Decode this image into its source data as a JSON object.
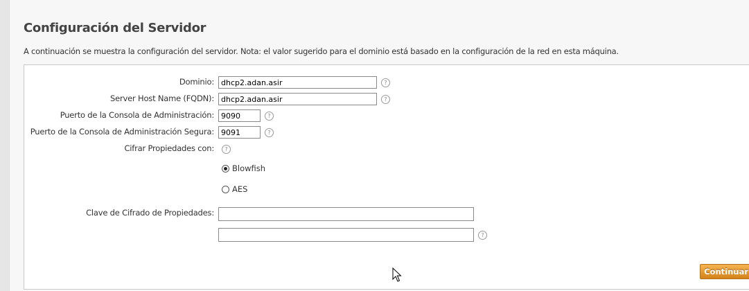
{
  "page": {
    "title": "Configuración del Servidor",
    "description": "A continuación se muestra la configuración del servidor. Nota: el valor sugerido para el dominio está basado en la configuración de la red en esta máquina."
  },
  "form": {
    "domain": {
      "label": "Dominio:",
      "value": "dhcp2.adan.asir"
    },
    "fqdn": {
      "label": "Server Host Name (FQDN):",
      "value": "dhcp2.adan.asir"
    },
    "admin_port": {
      "label": "Puerto de la Consola de Administración:",
      "value": "9090"
    },
    "admin_secure_port": {
      "label": "Puerto de la Consola de Administración Segura:",
      "value": "9091"
    },
    "encrypt": {
      "label": "Cifrar Propiedades con:",
      "options": [
        {
          "label": "Blowfish",
          "selected": true
        },
        {
          "label": "AES",
          "selected": false
        }
      ]
    },
    "encryption_key": {
      "label": "Clave de Cifrado de Propiedades:",
      "value": "",
      "confirm_value": ""
    },
    "help_glyph": "?",
    "continue_label": "Continuar"
  },
  "colors": {
    "button_accent": "#e39a34",
    "panel_border": "#c9c9c9"
  },
  "icons": {
    "help": "help-icon",
    "cursor": "mouse-pointer-icon"
  }
}
